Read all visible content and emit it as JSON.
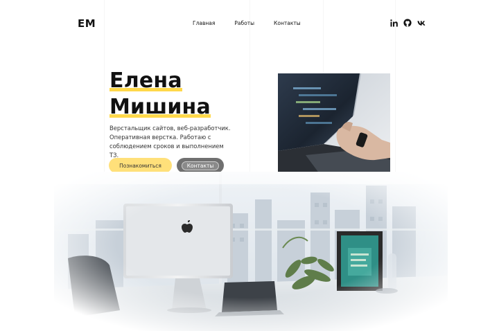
{
  "header": {
    "logo": "ЕМ",
    "nav": [
      "Главная",
      "Работы",
      "Контакты"
    ],
    "social_icons": [
      "linkedin-icon",
      "github-icon",
      "vk-icon"
    ]
  },
  "hero": {
    "name_line1": "Елена",
    "name_line2": "Мишина",
    "description": "Верстальщик сайтов, веб-разработчик. Оперативная верстка. Работаю с соблюдением сроков и выполнением ТЗ.",
    "primary_button": "Познакомиться",
    "secondary_button": "Контакты"
  },
  "colors": {
    "accent": "#ffd84a",
    "button_primary": "#ffe07a",
    "button_secondary": "#707070"
  }
}
